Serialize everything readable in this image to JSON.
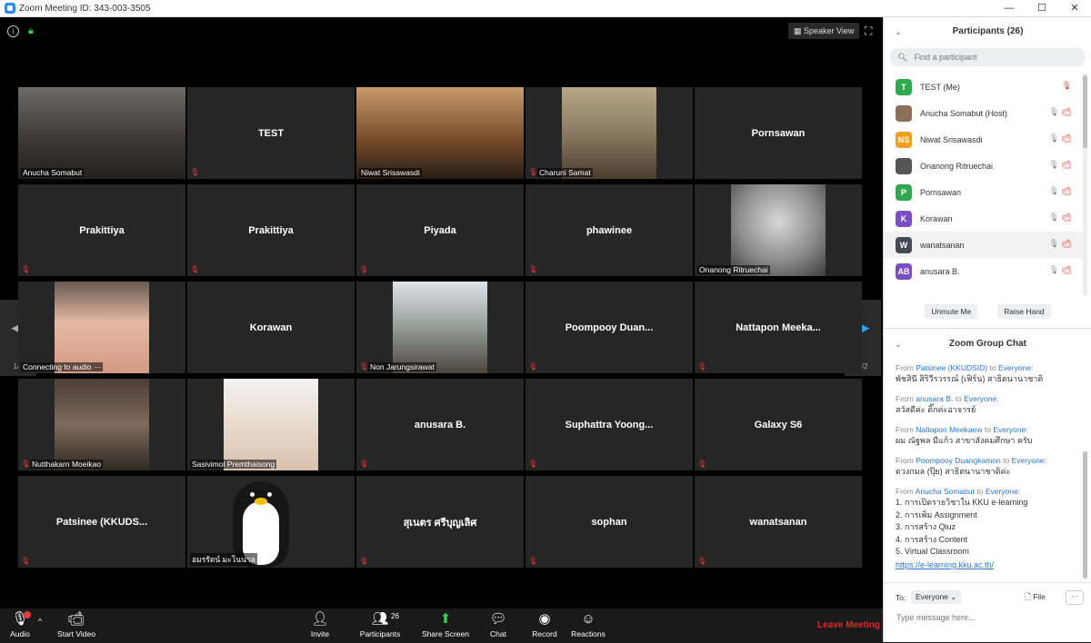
{
  "window": {
    "title": "Zoom Meeting ID: 343-003-3505",
    "minimize": "—",
    "maximize": "☐",
    "close": "✕"
  },
  "stage": {
    "speaker_view": "Speaker View"
  },
  "tiles": [
    {
      "name": "",
      "label": "Anucha Somabut",
      "video": "v-dark",
      "muted": false,
      "active": true
    },
    {
      "name": "TEST",
      "label": "",
      "video": "",
      "muted": true
    },
    {
      "name": "",
      "label": "Niwat Srisawasdi",
      "video": "v-warm",
      "muted": false
    },
    {
      "name": "",
      "label": "Charuni Samat",
      "video": "v-room",
      "muted": true
    },
    {
      "name": "Pornsawan",
      "label": "",
      "video": "",
      "muted": false
    },
    {
      "name": "Prakittiya",
      "label": "",
      "video": "",
      "muted": true
    },
    {
      "name": "Prakittiya",
      "label": "",
      "video": "",
      "muted": true
    },
    {
      "name": "Piyada",
      "label": "",
      "video": "",
      "muted": true
    },
    {
      "name": "phawinee",
      "label": "",
      "video": "",
      "muted": true
    },
    {
      "name": "",
      "label": "Onanong Ritruechai",
      "video": "v-cat",
      "muted": false
    },
    {
      "name": "",
      "label": "Connecting to audio ···",
      "video": "v-face",
      "muted": false
    },
    {
      "name": "Korawan",
      "label": "",
      "video": "",
      "muted": false
    },
    {
      "name": "",
      "label": "Non Jarungsirawat",
      "video": "v-mount",
      "muted": true
    },
    {
      "name": "Poompooy  Duan...",
      "label": "",
      "video": "",
      "muted": true
    },
    {
      "name": "Nattapon  Meeka...",
      "label": "",
      "video": "",
      "muted": true
    },
    {
      "name": "",
      "label": "Nutthakarn Moeikao",
      "video": "v-shop",
      "muted": true
    },
    {
      "name": "",
      "label": "Sasivimol Premthaisong",
      "video": "v-girl",
      "muted": false
    },
    {
      "name": "anusara B.",
      "label": "",
      "video": "",
      "muted": true
    },
    {
      "name": "Suphattra  Yoong...",
      "label": "",
      "video": "",
      "muted": true
    },
    {
      "name": "Galaxy S6",
      "label": "",
      "video": "",
      "muted": true
    },
    {
      "name": "Patsinee  (KKUDS...",
      "label": "",
      "video": "",
      "muted": true
    },
    {
      "name": "",
      "label": "อมรรัตน์ มะโนนาล",
      "video": "penguin",
      "muted": false
    },
    {
      "name": "สุเนตร ศรีบุญเลิศ",
      "label": "",
      "video": "",
      "muted": true
    },
    {
      "name": "sophan",
      "label": "",
      "video": "",
      "muted": true
    },
    {
      "name": "wanatsanan",
      "label": "",
      "video": "",
      "muted": true
    }
  ],
  "pager": {
    "left": "1/2",
    "right": "1/2"
  },
  "toolbar": {
    "audio": "Audio",
    "start_video": "Start Video",
    "invite": "Invite",
    "participants": "Participants",
    "participants_count": "26",
    "share_screen": "Share Screen",
    "chat": "Chat",
    "record": "Record",
    "reactions": "Reactions",
    "leave": "Leave Meeting"
  },
  "participants_panel": {
    "title": "Participants (26)",
    "search_placeholder": "Find a participant",
    "list": [
      {
        "initials": "T",
        "color": "#2fa84f",
        "name": "TEST (Me)",
        "mic": false
      },
      {
        "initials": "",
        "color": "#8a6f5a",
        "name": "Anucha Somabut (Host)",
        "mic": true
      },
      {
        "initials": "NS",
        "color": "#f0a01e",
        "name": "Niwat Srisawasdi",
        "mic": true
      },
      {
        "initials": "",
        "color": "#555555",
        "name": "Onanong Ritruechai",
        "mic": true
      },
      {
        "initials": "P",
        "color": "#2fa84f",
        "name": "Pornsawan",
        "mic": true
      },
      {
        "initials": "K",
        "color": "#7b4fc4",
        "name": "Korawan",
        "mic": true
      },
      {
        "initials": "W",
        "color": "#444b56",
        "name": "wanatsanan",
        "mic": true
      },
      {
        "initials": "AB",
        "color": "#7b4fc4",
        "name": "anusara B.",
        "mic": false
      }
    ],
    "unmute": "Unmute Me",
    "raise_hand": "Raise Hand"
  },
  "chat": {
    "title": "Zoom Group Chat",
    "messages": [
      {
        "from_label": "From",
        "sender": "Patsinee (KKUDSID)",
        "to_label": "to",
        "recipient": "Everyone:",
        "text": [
          "พัชสินี สิริวีรวรรณ์ (เฟิร์น) สาธิตนานาชาติ"
        ]
      },
      {
        "from_label": "From",
        "sender": "anusara B.",
        "to_label": "to",
        "recipient": "Everyone:",
        "text": [
          "สวัสดีค่ะ ดิ๊กค่ะอาจารย์"
        ]
      },
      {
        "from_label": "From",
        "sender": "Nattapon Meekaew",
        "to_label": "to",
        "recipient": "Everyone:",
        "text": [
          "ผม ณัฐพล มีแก้ว สาขาสังคมศึกษา ครับ"
        ]
      },
      {
        "from_label": "From",
        "sender": "Poompooy Duangkamon",
        "to_label": "to",
        "recipient": "Everyone:",
        "text": [
          "ดวงกมล (ปุ๊ย) สาธิตนานาชาติค่ะ"
        ]
      },
      {
        "from_label": "From",
        "sender": "Anucha Somabut",
        "to_label": "to",
        "recipient": "Everyone:",
        "text": [
          "1. การเปิดรายวิชาใน KKU e-learning",
          "2. การเพิ่ม Assignment",
          "3. การสร้าง Qiuz",
          "4. การสร้าง Content",
          "5. Virtual Classroom"
        ],
        "link": "https://e-learning.kku.ac.th/"
      }
    ],
    "to": "To:",
    "recipient": "Everyone",
    "file": "File",
    "more": "···",
    "placeholder": "Type message here..."
  }
}
